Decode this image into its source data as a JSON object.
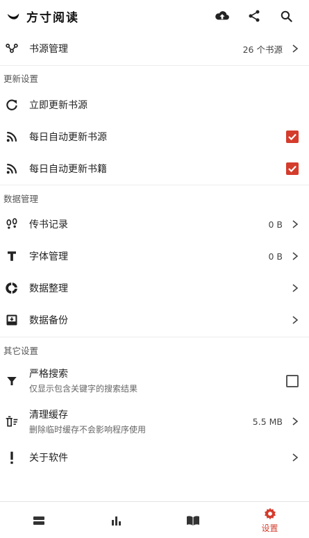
{
  "app": {
    "title": "方寸阅读"
  },
  "toolbar": {
    "upload_icon": "cloud-upload-icon",
    "share_icon": "share-icon",
    "search_icon": "search-icon"
  },
  "book_source": {
    "label": "书源管理",
    "value": "26 个书源"
  },
  "sections": {
    "update": "更新设置",
    "data": "数据管理",
    "other": "其它设置"
  },
  "update_settings": {
    "refresh_now": "立即更新书源",
    "auto_source": {
      "label": "每日自动更新书源",
      "checked": true
    },
    "auto_books": {
      "label": "每日自动更新书籍",
      "checked": true
    }
  },
  "data_mgmt": {
    "transfer": {
      "label": "传书记录",
      "value": "0 B"
    },
    "fonts": {
      "label": "字体管理",
      "value": "0 B"
    },
    "organize": {
      "label": "数据整理"
    },
    "backup": {
      "label": "数据备份"
    }
  },
  "other_settings": {
    "strict_search": {
      "label": "严格搜索",
      "desc": "仅显示包含关键字的搜索结果",
      "checked": false
    },
    "clear_cache": {
      "label": "清理缓存",
      "desc": "删除临时缓存不会影响程序使用",
      "value": "5.5 MB"
    },
    "about": {
      "label": "关于软件"
    }
  },
  "bottom_nav": {
    "active_label": "设置"
  },
  "colors": {
    "accent": "#d43c2c",
    "text": "#222222",
    "muted": "#666666"
  }
}
